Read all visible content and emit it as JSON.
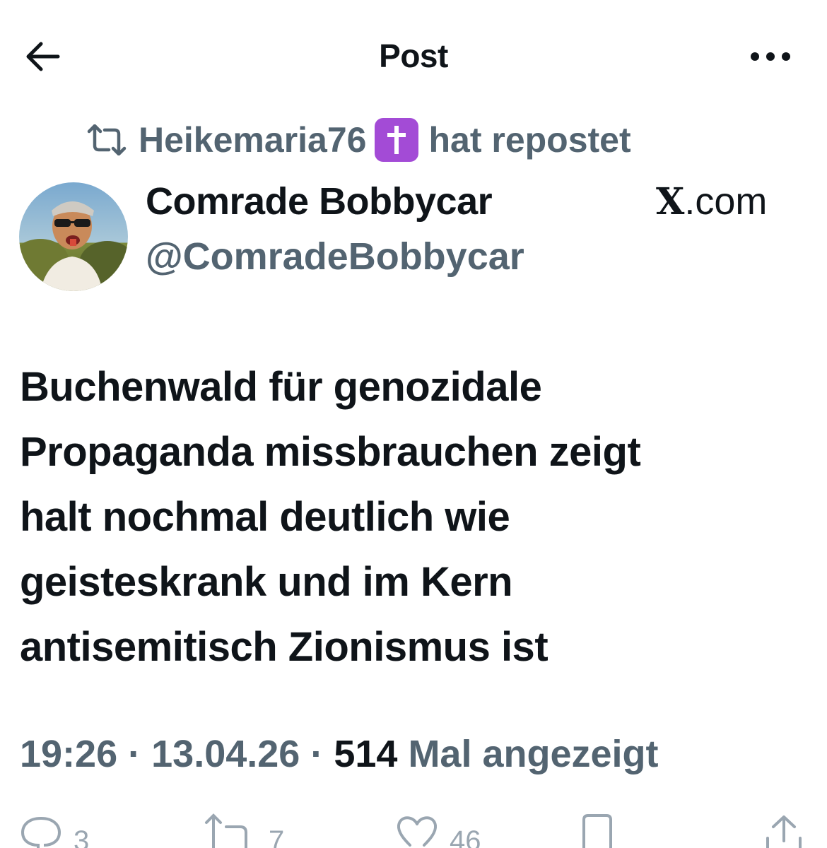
{
  "header": {
    "title": "Post",
    "back_icon": "arrow-left-icon",
    "more_icon": "more-horizontal-icon"
  },
  "repost": {
    "reposter": "Heikemaria76",
    "suffix": "hat repostet",
    "badge_color": "#a34bd6"
  },
  "author": {
    "name": "Comrade Bobbycar",
    "handle": "@ComradeBobbycar"
  },
  "source": {
    "x": "X",
    "domain": ".com"
  },
  "tweet": {
    "lines": [
      "Buchenwald für genozidale",
      "Propaganda missbrauchen zeigt",
      "halt nochmal deutlich wie",
      "geisteskrank und im Kern",
      "antisemitisch Zionismus ist"
    ]
  },
  "meta": {
    "time": "19:26",
    "sep1": " · ",
    "date": "13.04.26",
    "sep2": " · ",
    "views_count": "514",
    "views_label": " Mal angezeigt"
  },
  "actions": {
    "replies": "3",
    "reposts": "7",
    "likes": "46"
  },
  "colors": {
    "text": "#0f1419",
    "secondary": "#536471",
    "action_gray": "#9aa6b1"
  }
}
